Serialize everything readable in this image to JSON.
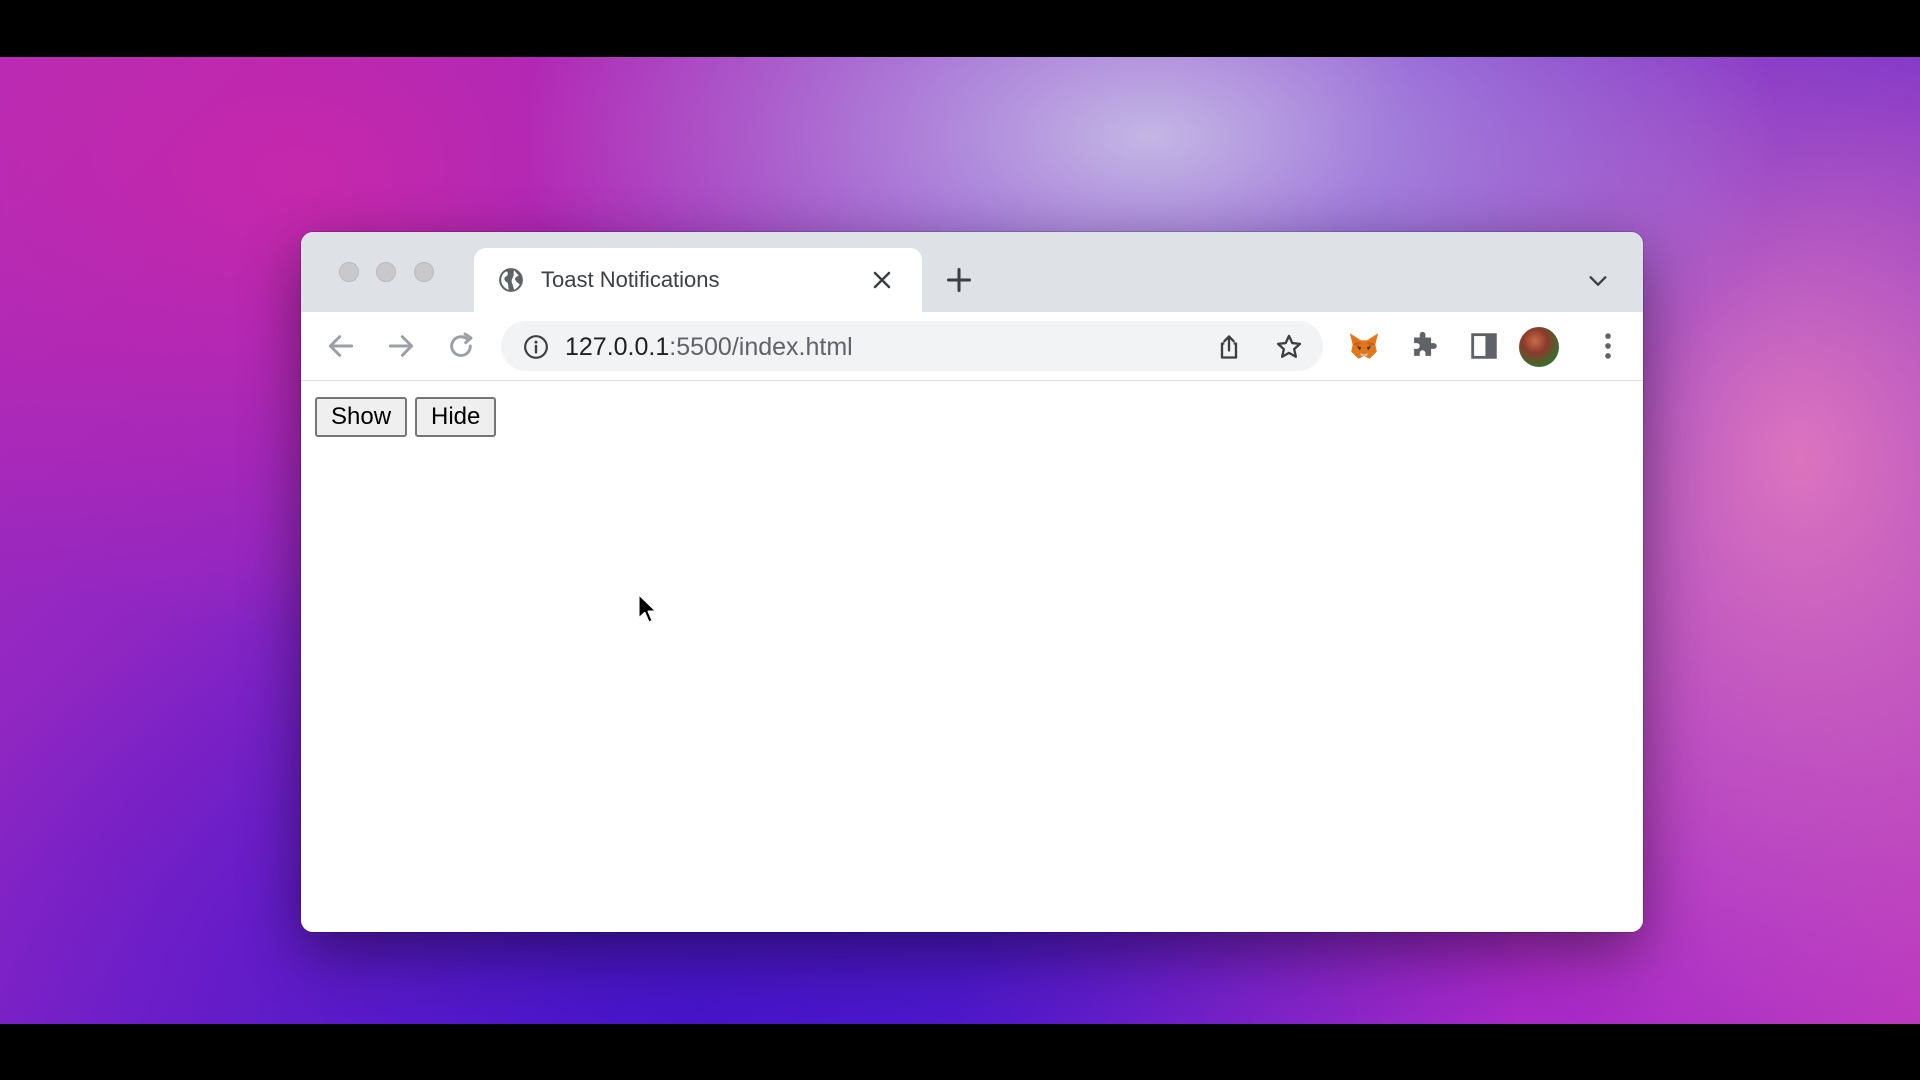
{
  "browser": {
    "tab": {
      "title": "Toast Notifications",
      "icon": "globe-icon"
    },
    "address_bar": {
      "url_host": "127.0.0.1",
      "url_rest": ":5500/index.html"
    },
    "toolbar_icons": [
      "back-arrow-icon",
      "forward-arrow-icon",
      "reload-icon",
      "site-info-icon",
      "share-icon",
      "bookmark-star-icon",
      "metamask-fox-icon",
      "extensions-puzzle-icon",
      "side-panel-icon",
      "profile-avatar",
      "menu-kebab-icon"
    ]
  },
  "page": {
    "buttons": {
      "show_label": "Show",
      "hide_label": "Hide"
    }
  },
  "colors": {
    "tabstrip": "#dee1e6",
    "omnibox": "#f1f3f4",
    "icon": "#5f6368"
  }
}
